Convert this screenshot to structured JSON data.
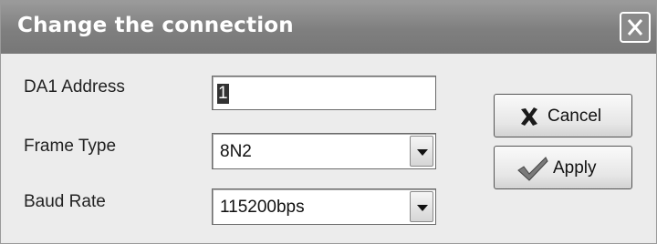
{
  "window": {
    "title": "Change the connection"
  },
  "form": {
    "address_label": "DA1 Address",
    "address_value": "1",
    "frame_label": "Frame Type",
    "frame_value": "8N2",
    "baud_label": "Baud Rate",
    "baud_value": "115200bps"
  },
  "buttons": {
    "cancel_label": "Cancel",
    "apply_label": "Apply"
  },
  "icons": {
    "close": "close-icon",
    "cancel": "x-mark-icon",
    "apply": "checkmark-icon",
    "dropdown": "chevron-down-icon"
  }
}
